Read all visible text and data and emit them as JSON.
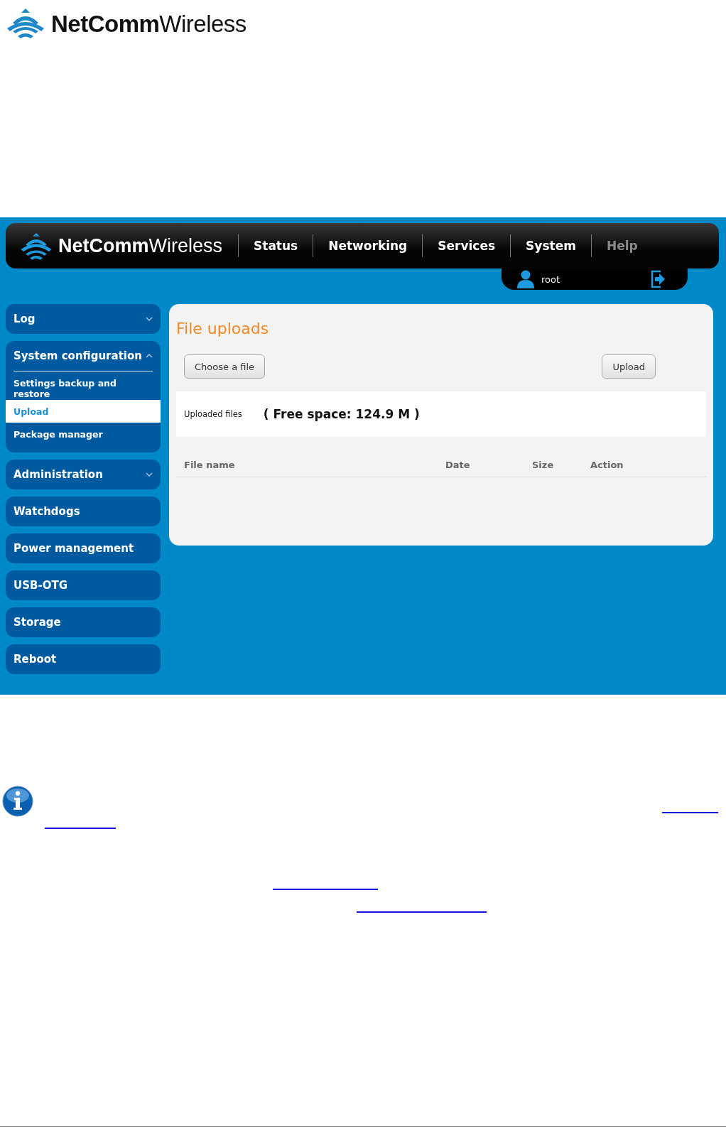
{
  "document_logo": {
    "brand_bold": "NetComm",
    "brand_light": "Wireless"
  },
  "header": {
    "logo": {
      "brand_bold": "NetComm",
      "brand_light": "Wireless"
    },
    "nav": [
      {
        "label": "Status",
        "disabled": false
      },
      {
        "label": "Networking",
        "disabled": false
      },
      {
        "label": "Services",
        "disabled": false
      },
      {
        "label": "System",
        "disabled": false
      },
      {
        "label": "Help",
        "disabled": true
      }
    ],
    "user": "root"
  },
  "sidebar": {
    "items": [
      {
        "label": "Log",
        "kind": "group",
        "expanded": false
      },
      {
        "label": "System configuration",
        "kind": "group",
        "expanded": true,
        "children": [
          {
            "label": "Settings backup and restore",
            "selected": false
          },
          {
            "label": "Upload",
            "selected": true
          },
          {
            "label": "Package manager",
            "selected": false
          }
        ]
      },
      {
        "label": "Administration",
        "kind": "group",
        "expanded": false
      },
      {
        "label": "Watchdogs",
        "kind": "link"
      },
      {
        "label": "Power management",
        "kind": "link"
      },
      {
        "label": "USB-OTG",
        "kind": "link"
      },
      {
        "label": "Storage",
        "kind": "link"
      },
      {
        "label": "Reboot",
        "kind": "link"
      }
    ]
  },
  "panel": {
    "title": "File uploads",
    "choose_button": "Choose a file",
    "upload_button": "Upload",
    "uploaded_label": "Uploaded files",
    "free_space": "( Free space: 124.9 M )",
    "table": {
      "columns": [
        "File name",
        "Date",
        "Size",
        "Action"
      ]
    }
  }
}
